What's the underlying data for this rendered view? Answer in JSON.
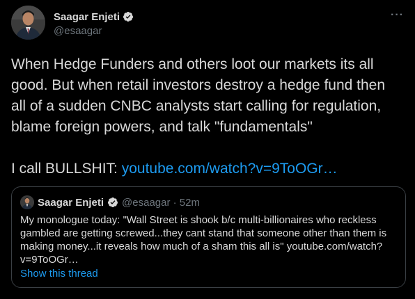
{
  "author": {
    "display_name": "Saagar Enjeti",
    "handle": "@esaagar",
    "avatar": "profile-photo",
    "verified": true
  },
  "more_menu": {
    "label": "···"
  },
  "tweet": {
    "lines": [
      "When Hedge Funders and others loot our markets its all",
      "good. But when retail investors destroy a hedge fund then",
      "all of a sudden CNBC analysts start calling for regulation,",
      "blame foreign powers, and talk \"fundamentals\""
    ],
    "closing_text": "I call BULLSHIT: ",
    "link_text": "youtube.com/watch?v=9ToOGr…"
  },
  "quote": {
    "display_name": "Saagar Enjeti",
    "handle_time": "@esaagar · 52m",
    "lines": [
      "My monologue today: \"Wall Street is shook b/c multi-billionaires who reckless",
      "gambled are getting screwed...they cant stand that someone other than them is",
      "making money...it reveals how much of a sham this all is\" youtube.com/watch?",
      "v=9ToOGr…"
    ],
    "show_thread": "Show this thread"
  },
  "colors": {
    "background": "#000000",
    "text": "#d9d9d9",
    "secondary": "#6e767d",
    "link": "#1d9bf0",
    "verified": "#1d9bf0",
    "border": "#3a3f44"
  }
}
